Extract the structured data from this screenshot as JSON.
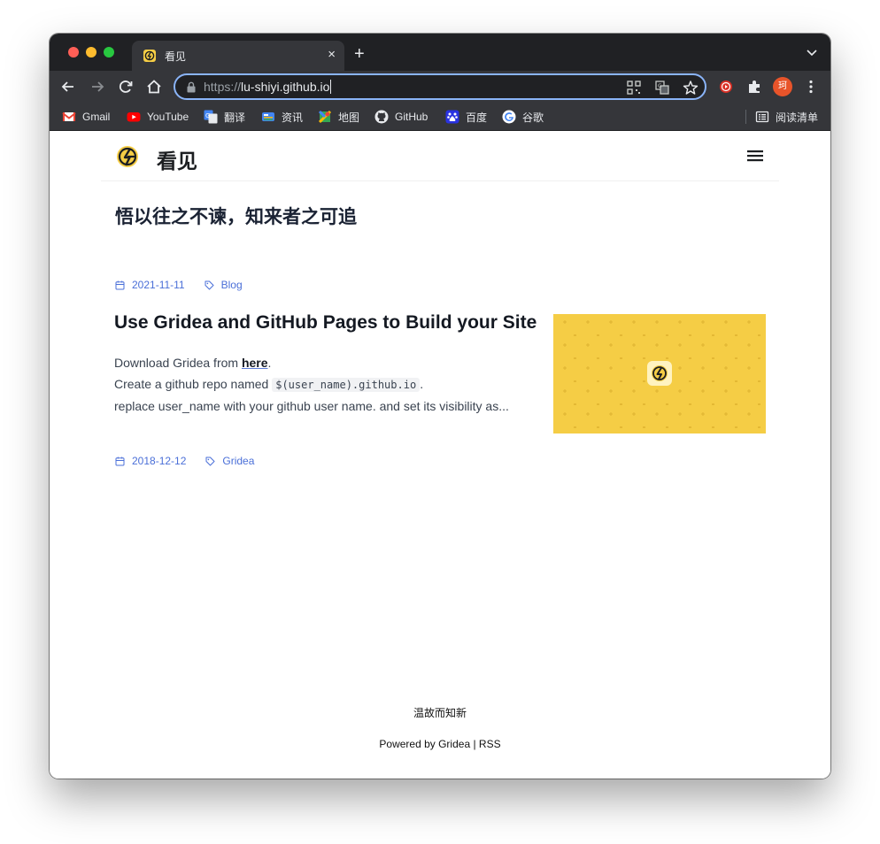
{
  "browser": {
    "tab_title": "看见",
    "tab_close": "×",
    "new_tab": "+",
    "url_scheme": "https://",
    "url_host": "lu-shiyi.github.io",
    "profile_initial": "珂"
  },
  "bookmarks": [
    {
      "label": "Gmail",
      "icon": "gmail-icon"
    },
    {
      "label": "YouTube",
      "icon": "youtube-icon"
    },
    {
      "label": "翻译",
      "icon": "translate-icon"
    },
    {
      "label": "资讯",
      "icon": "news-icon"
    },
    {
      "label": "地图",
      "icon": "maps-icon"
    },
    {
      "label": "GitHub",
      "icon": "github-icon"
    },
    {
      "label": "百度",
      "icon": "baidu-icon"
    },
    {
      "label": "谷歌",
      "icon": "google-icon"
    }
  ],
  "reading_list_label": "阅读清单",
  "site": {
    "name": "看见",
    "accent_color": "#4a6fd8",
    "logo_color": "#f5cd45"
  },
  "posts": [
    {
      "title": "悟以往之不谏，知来者之可追",
      "date": "2021-11-11",
      "tag": "Blog"
    },
    {
      "title": "Use Gridea and GitHub Pages to Build your Site",
      "excerpt_line1_prefix": "Download Gridea from ",
      "excerpt_line1_link": "here",
      "excerpt_line1_suffix": ".",
      "excerpt_line2_prefix": "Create a github repo named ",
      "excerpt_line2_code": "$(user_name).github.io",
      "excerpt_line2_suffix": ".",
      "excerpt_line3": "replace user_name with your github user name. and set its visibility as...",
      "date": "2018-12-12",
      "tag": "Gridea"
    }
  ],
  "footer": {
    "motto": "温故而知新",
    "powered_prefix": "Powered by ",
    "powered_link": "Gridea",
    "separator": " | ",
    "rss": "RSS"
  }
}
